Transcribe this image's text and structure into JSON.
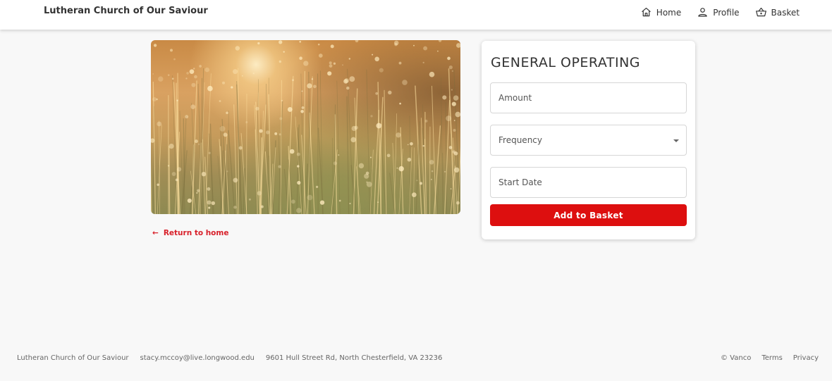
{
  "header": {
    "brand": "Lutheran Church of Our Saviour",
    "nav": {
      "home": "Home",
      "profile": "Profile",
      "basket": "Basket"
    }
  },
  "hero": {
    "image": "golden-grass-sunlight-photo"
  },
  "back_link": {
    "arrow": "←",
    "label": "Return to home"
  },
  "form": {
    "title": "GENERAL OPERATING",
    "amount_placeholder": "Amount",
    "frequency_placeholder": "Frequency",
    "start_date_placeholder": "Start Date",
    "submit_label": "Add to Basket"
  },
  "footer": {
    "org": "Lutheran Church of Our Saviour",
    "email": "stacy.mccoy@live.longwood.edu",
    "address": "9601 Hull Street Rd, North Chesterfield, VA 23236",
    "vanco": "© Vanco",
    "terms": "Terms",
    "privacy": "Privacy"
  },
  "colors": {
    "accent": "#dd0f0f",
    "link": "#d8202a",
    "background": "#f8f8f8"
  }
}
